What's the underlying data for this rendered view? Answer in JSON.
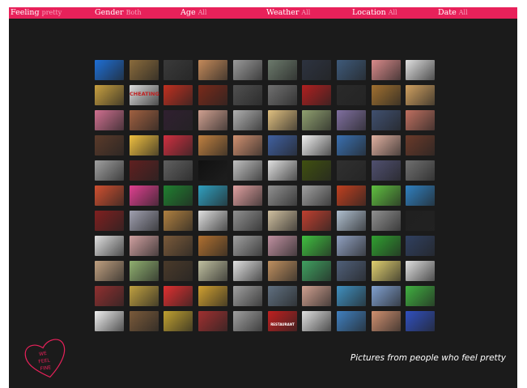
{
  "filters": [
    {
      "name": "feeling",
      "label": "Feeling",
      "value": "pretty"
    },
    {
      "name": "gender",
      "label": "Gender",
      "value": "Both"
    },
    {
      "name": "age",
      "label": "Age",
      "value": "All"
    },
    {
      "name": "weather",
      "label": "Weather",
      "value": "All"
    },
    {
      "name": "location",
      "label": "Location",
      "value": "All"
    },
    {
      "name": "date",
      "label": "Date",
      "value": "All"
    }
  ],
  "logo": {
    "line1": "WE",
    "line2": "FEEL",
    "line3": "FINE",
    "icon": "heart-icon",
    "color": "#e8215a"
  },
  "caption": "Pictures from people who feel pretty",
  "photo_grid": {
    "rows": 11,
    "cols": 10
  },
  "photo_labels": {
    "cheating": "CHEATING",
    "restaurant": "RESTAURANT"
  },
  "colors": {
    "accent": "#e8215a",
    "background": "#1b1b1b",
    "filter_label": "#ffffff",
    "filter_value": "#f5a3bd",
    "caption": "#ffffff"
  },
  "thumb_colors": [
    [
      "#1e6fd6",
      "#8a6b3c",
      "#3a3a3a",
      "#c48a5a",
      "#9a9a9a",
      "#6c7a6c",
      "#2d3340",
      "#3e5a7a",
      "#d98a8a",
      "#e0e0e0"
    ],
    [
      "#c8a040",
      "#dddddd",
      "#c03020",
      "#7a2a1a",
      "#505050",
      "#707070",
      "#b02020",
      "#2a2a2a",
      "#a07030",
      "#d0a060"
    ],
    [
      "#d07090",
      "#a06040",
      "#302030",
      "#d0a090",
      "#b0b0b0",
      "#e0c080",
      "#90a070",
      "#8070a0",
      "#405070",
      "#c07060"
    ],
    [
      "#5a3a2a",
      "#f0c040",
      "#d03040",
      "#c08040",
      "#d09070",
      "#4060a0",
      "#f0f0f0",
      "#3a70b0",
      "#e0b0a0",
      "#6a3a2a"
    ],
    [
      "#a0a0a0",
      "#602020",
      "#606060",
      "#101010",
      "#c0c0c0",
      "#e0e0e0",
      "#405010",
      "#303030",
      "#505070",
      "#707070"
    ],
    [
      "#d05030",
      "#e04090",
      "#208030",
      "#30a0c0",
      "#e0a0a0",
      "#909090",
      "#a0a0a0",
      "#c04020",
      "#60c040",
      "#3080c0"
    ],
    [
      "#802020",
      "#a0a0b0",
      "#b08040",
      "#e0e0e0",
      "#909090",
      "#d0c0a0",
      "#c04030",
      "#b0c0d0",
      "#909090",
      "#202020"
    ],
    [
      "#e0e0e0",
      "#d0a0a0",
      "#7a5a3a",
      "#b07030",
      "#a0a0a0",
      "#c090a0",
      "#40c040",
      "#90a0c0",
      "#30a030",
      "#304060"
    ],
    [
      "#c0a080",
      "#90b070",
      "#4a3a2a",
      "#c0c0a0",
      "#e0e0e0",
      "#c09060",
      "#40a060",
      "#50607a",
      "#e0d070",
      "#e0e0e0"
    ],
    [
      "#903030",
      "#c0a040",
      "#e03030",
      "#d0a030",
      "#a0a0a0",
      "#607080",
      "#d0a090",
      "#4090c0",
      "#80a0d0",
      "#40b040"
    ],
    [
      "#f0f0f0",
      "#7a5a3a",
      "#c0a030",
      "#a03030",
      "#a0a0a0",
      "#c02020",
      "#e0e0e0",
      "#4080c0",
      "#d09070",
      "#3050c0"
    ]
  ]
}
